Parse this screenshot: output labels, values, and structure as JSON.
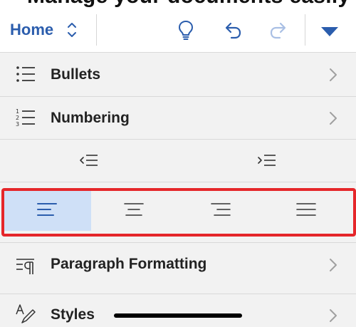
{
  "partial_top_text": "Manage your documents easily",
  "toolbar": {
    "home_label": "Home",
    "home_chevron_icon": "chevron-up-down-icon",
    "tell_me_icon": "lightbulb-icon",
    "undo_icon": "undo-icon",
    "redo_icon": "redo-icon",
    "collapse_icon": "triangle-down-icon",
    "accent_color": "#2b5dad"
  },
  "menu": {
    "bullets_label": "Bullets",
    "numbering_label": "Numbering",
    "decrease_indent_icon": "decrease-indent-icon",
    "increase_indent_icon": "increase-indent-icon",
    "paragraph_label": "Paragraph Formatting",
    "styles_label": "Styles"
  },
  "alignment": {
    "options": [
      "align-left",
      "align-center",
      "align-right",
      "justify"
    ],
    "selected": "align-left",
    "selected_color": "#cfe0f7",
    "highlight_color": "#e5262a"
  }
}
